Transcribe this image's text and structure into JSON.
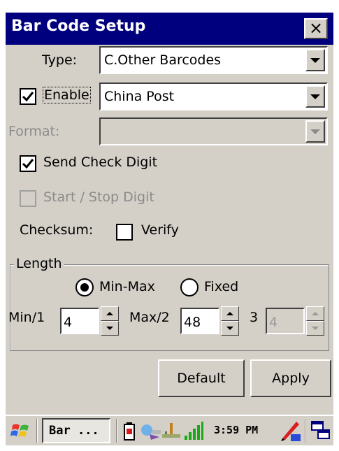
{
  "window": {
    "title": "Bar Code Setup",
    "close_label": "×"
  },
  "type_field": {
    "label": "Type:",
    "value": "C.Other Barcodes"
  },
  "enable_field": {
    "label": "Enable",
    "checked": true,
    "value": "China Post"
  },
  "format_field": {
    "label": "Format:",
    "value": ""
  },
  "send_check_digit": {
    "label": "Send Check Digit",
    "checked": true
  },
  "start_stop_digit": {
    "label": "Start / Stop Digit",
    "checked": false
  },
  "checksum": {
    "label": "Checksum:",
    "verify_label": "Verify",
    "checked": false
  },
  "length": {
    "legend": "Length",
    "min_max_label": "Min-Max",
    "fixed_label": "Fixed",
    "selected": "Min-Max",
    "min_label": "Min/1",
    "min_value": "4",
    "max_label": "Max/2",
    "max_value": "48",
    "third_label": "3",
    "third_value": "4"
  },
  "buttons": {
    "default_label": "Default",
    "apply_label": "Apply"
  },
  "taskbar": {
    "task_label": "Bar ...",
    "clock": "3:59 PM",
    "icons": [
      "windows-start-icon",
      "battery-icon",
      "network-icon",
      "usb-icon",
      "signal-icon",
      "input-panel-icon",
      "task-switch-icon"
    ]
  },
  "colors": {
    "title_bar": "#00007f",
    "dialog_bg": "#d4d0c8",
    "disabled_text": "#8a8a8a"
  }
}
